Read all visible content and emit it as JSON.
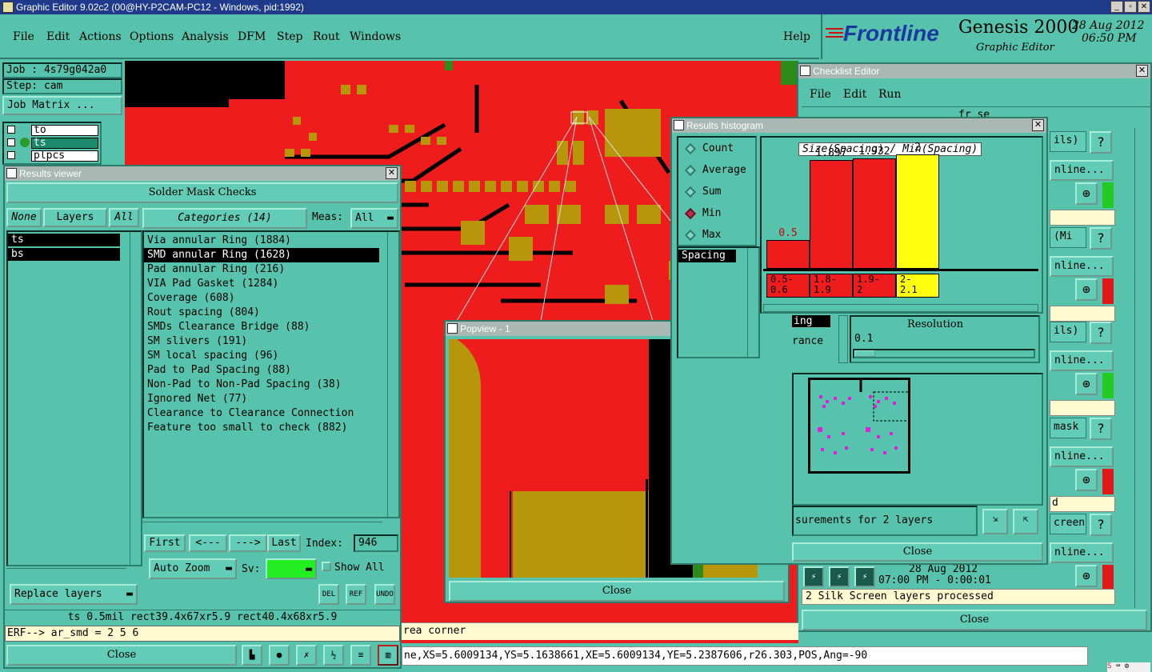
{
  "app": {
    "title": "Graphic Editor 9.02c2 (00@HY-P2CAM-PC12 - Windows, pid:1992)"
  },
  "menu": [
    "File",
    "Edit",
    "Actions",
    "Options",
    "Analysis",
    "DFM",
    "Step",
    "Rout",
    "Windows"
  ],
  "help_label": "Help",
  "brand": {
    "logo": "Frontline",
    "product": "Genesis 2000",
    "subtitle": "Graphic Editor",
    "date": "28 Aug 2012",
    "time": "06:50 PM"
  },
  "job_panel": {
    "job": "Job : 4s79g042a0",
    "step": "Step: cam",
    "matrix_button": "Job Matrix ...",
    "layers": [
      "to",
      "ts",
      "plpcs"
    ]
  },
  "results_viewer": {
    "title": "Results viewer",
    "header": "Solder Mask Checks",
    "none": "None",
    "layers": "Layers",
    "all": "All",
    "categories_label": "Categories (14)",
    "meas_label": "Meas:",
    "meas_value": "All",
    "layer_list": [
      "ts",
      "bs"
    ],
    "categories": [
      "Via annular Ring (1884)",
      "SMD annular Ring (1628)",
      "Pad annular Ring (216)",
      "VIA Pad Gasket (1284)",
      "Coverage (608)",
      "Rout spacing (804)",
      "SMDs Clearance Bridge (88)",
      "SM slivers (191)",
      "SM local spacing (96)",
      "Pad to Pad Spacing (88)",
      "Non-Pad to Non-Pad Spacing (38)",
      "Ignored Net (77)",
      "Clearance to Clearance Connection",
      "Feature too small to check (882)"
    ],
    "selected_index": 1,
    "first": "First",
    "prev": "<---",
    "next": "--->",
    "last": "Last",
    "index_label": "Index:",
    "index_value": "946",
    "auto_zoom": "Auto Zoom",
    "sv_label": "Sv:",
    "show_all": "Show All",
    "replace_layers": "Replace layers",
    "del_icon": "DEL",
    "ref_icon": "REF",
    "undo_icon": "UNDO",
    "status_line": "ts 0.5mil   rect39.4x67xr5.9   rect40.4x68xr5.9",
    "erf_line": "ERF--> ar_smd = 2 5 6",
    "close": "Close"
  },
  "popview": {
    "title": "Popview - 1",
    "close": "Close"
  },
  "histogram": {
    "title": "Results histogram",
    "options": [
      "Count",
      "Average",
      "Sum",
      "Min",
      "Max"
    ],
    "selected_option": "Min",
    "list_item": "Spacing",
    "chart_title": "Size(Spacing) / Min(Spacing)",
    "resolution_label": "Resolution",
    "resolution_value": "0.1",
    "left_labels": [
      "ing",
      "rance"
    ],
    "measurements_text": "surements for 2 layers",
    "close": "Close"
  },
  "chart_data": {
    "type": "bar",
    "categories": [
      "0.5-\n0.6",
      "1.8-\n1.9",
      "1.9-\n2",
      "2-\n2.1"
    ],
    "values": [
      0.5,
      1.897,
      1.932,
      2
    ],
    "value_labels": [
      "0.5",
      "1.897",
      "1.932",
      "2"
    ],
    "colors": [
      "#ee1c1c",
      "#ee1c1c",
      "#ee1c1c",
      "#ffff10"
    ],
    "ylim": [
      0,
      2.1
    ]
  },
  "checklist": {
    "title": "Checklist Editor",
    "menu": [
      "File",
      "Edit",
      "Run"
    ],
    "hint": "fr_se",
    "side_texts": [
      "ils)",
      "nline...",
      "(Mi",
      "nline...",
      "ils)",
      "nline...",
      "mask",
      "nline...",
      "d",
      "creen",
      "nline..."
    ],
    "footer_date": "28 Aug 2012",
    "footer_time": "07:00 PM - 0:00:01",
    "footer_status": "2 Silk Screen layers processed",
    "close": "Close"
  },
  "bottom": {
    "area_text": "rea corner",
    "coords": "ne,XS=5.6009134,YS=5.1638661,XE=5.6009134,YE=5.2387606,r26.303,POS,Ang=-90"
  }
}
